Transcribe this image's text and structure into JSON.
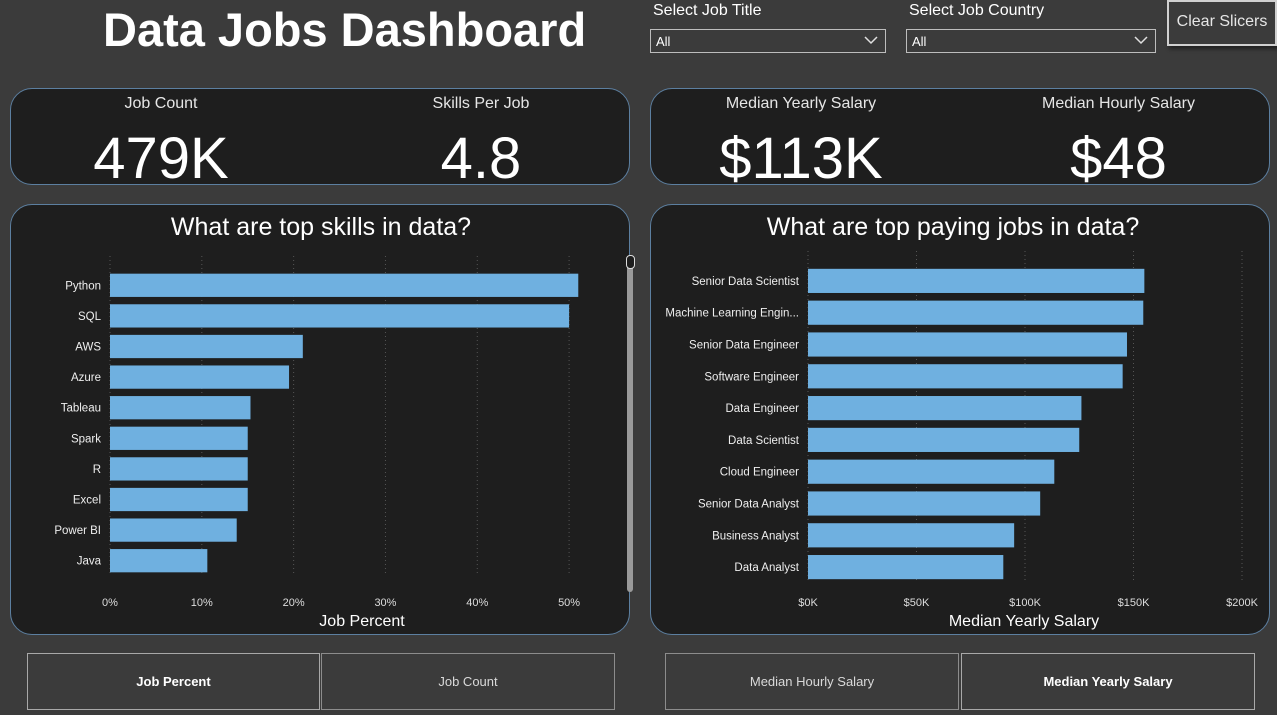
{
  "header": {
    "title": "Data Jobs Dashboard",
    "job_title_label": "Select Job Title",
    "job_title_value": "All",
    "job_country_label": "Select Job Country",
    "job_country_value": "All",
    "clear_label": "Clear Slicers"
  },
  "kpis": [
    {
      "label": "Job Count",
      "value": "479K"
    },
    {
      "label": "Skills Per Job",
      "value": "4.8"
    },
    {
      "label": "Median Yearly Salary",
      "value": "$113K"
    },
    {
      "label": "Median Hourly Salary",
      "value": "$48"
    }
  ],
  "colors": {
    "bar": "#6fb0e0",
    "card": "#1e1e1e",
    "background": "#3b3b3b",
    "card_border": "#5c7fa0"
  },
  "chart_data": [
    {
      "type": "bar",
      "orientation": "horizontal",
      "title": "What are top skills in data?",
      "xlabel": "Job Percent",
      "ylabel": "",
      "categories": [
        "Python",
        "SQL",
        "AWS",
        "Azure",
        "Tableau",
        "Spark",
        "R",
        "Excel",
        "Power BI",
        "Java"
      ],
      "values": [
        51,
        50,
        21,
        19.5,
        15.3,
        15,
        15,
        15,
        13.8,
        10.6
      ],
      "xticks": [
        "0%",
        "10%",
        "20%",
        "30%",
        "40%",
        "50%"
      ],
      "xlim": [
        0,
        55
      ],
      "grid": "vertical dotted"
    },
    {
      "type": "bar",
      "orientation": "horizontal",
      "title": "What are top paying jobs in data?",
      "xlabel": "Median Yearly Salary",
      "ylabel": "",
      "categories": [
        "Senior Data Scientist",
        "Machine Learning Engin...",
        "Senior Data Engineer",
        "Software Engineer",
        "Data Engineer",
        "Data Scientist",
        "Cloud Engineer",
        "Senior Data Analyst",
        "Business Analyst",
        "Data Analyst"
      ],
      "values": [
        155000,
        154500,
        147000,
        145000,
        126000,
        125000,
        113500,
        107000,
        95000,
        90000
      ],
      "xticks": [
        "$0K",
        "$50K",
        "$100K",
        "$150K",
        "$200K"
      ],
      "xlim": [
        0,
        200000
      ],
      "grid": "vertical dotted"
    }
  ],
  "toggles_left": [
    {
      "label": "Job Percent",
      "active": true
    },
    {
      "label": "Job Count",
      "active": false
    }
  ],
  "toggles_right": [
    {
      "label": "Median Hourly Salary",
      "active": false
    },
    {
      "label": "Median Yearly Salary",
      "active": true
    }
  ]
}
